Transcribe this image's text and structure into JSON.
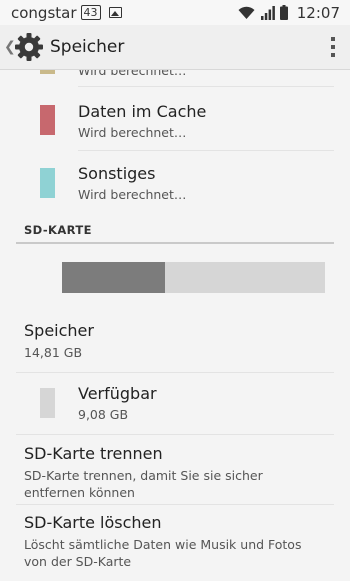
{
  "status_bar": {
    "carrier": "congstar",
    "badge": "43",
    "time": "12:07",
    "icons": [
      "notification-badge-icon",
      "picture-notification-icon",
      "wifi-icon",
      "signal-icon",
      "battery-icon"
    ]
  },
  "action_bar": {
    "title": "Speicher",
    "icons": [
      "back-chevron-icon",
      "settings-gear-icon",
      "overflow-menu-icon"
    ]
  },
  "internal_partial": {
    "subtitle": "Wird berechnet…",
    "color": "#c9b98a"
  },
  "categories": [
    {
      "label": "Daten im Cache",
      "subtitle": "Wird berechnet…",
      "color": "#c7686e"
    },
    {
      "label": "Sonstiges",
      "subtitle": "Wird berechnet…",
      "color": "#8fd2d4"
    }
  ],
  "sd_card": {
    "section_title": "SD-KARTE",
    "usage_fraction": 0.39,
    "used_color": "#7c7c7c",
    "free_color": "#d6d6d6",
    "total": {
      "label": "Speicher",
      "value": "14,81 GB"
    },
    "available": {
      "label": "Verfügbar",
      "value": "9,08 GB",
      "color": "#d6d6d6"
    },
    "unmount": {
      "label": "SD-Karte trennen",
      "description": "SD-Karte trennen, damit Sie sie sicher entfernen können"
    },
    "erase": {
      "label": "SD-Karte löschen",
      "description": "Löscht sämtliche Daten wie Musik und Fotos von der SD-Karte"
    }
  }
}
